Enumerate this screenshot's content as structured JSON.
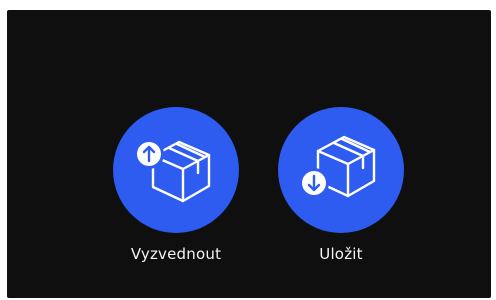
{
  "actions": [
    {
      "label": "Vyzvednout",
      "icon": "box-arrow-up-icon"
    },
    {
      "label": "Uložit",
      "icon": "box-arrow-down-icon"
    }
  ],
  "colors": {
    "background": "#0f0f10",
    "button": "#2e5bf0",
    "icon": "#ffffff",
    "text": "#f4f4f4"
  }
}
